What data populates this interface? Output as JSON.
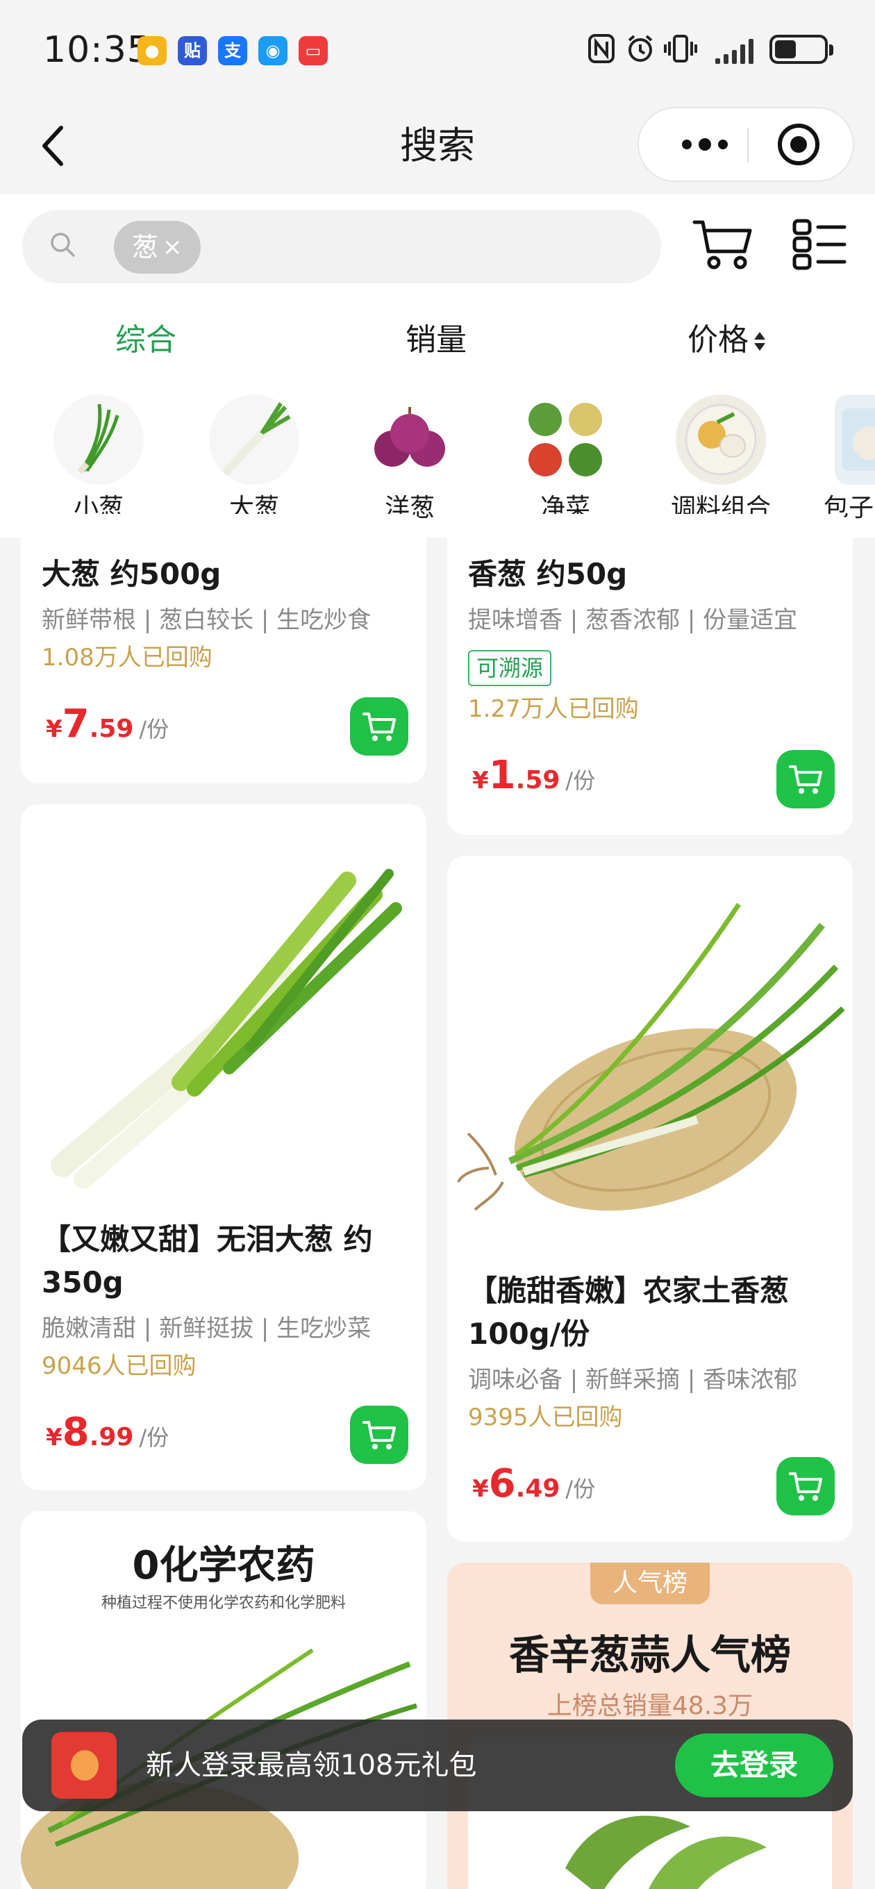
{
  "status_bar": {
    "time": "10:35",
    "notification_icons": [
      "weibo-icon",
      "tieba-icon",
      "alipay-icon",
      "message-icon",
      "mail-icon"
    ]
  },
  "nav": {
    "title": "搜索"
  },
  "search": {
    "query_chip": "葱",
    "clear_glyph": "×"
  },
  "sort_tabs": [
    {
      "label": "综合",
      "active": true
    },
    {
      "label": "销量",
      "active": false
    },
    {
      "label": "价格",
      "active": false
    }
  ],
  "categories": [
    {
      "label": "小葱"
    },
    {
      "label": "大葱"
    },
    {
      "label": "洋葱"
    },
    {
      "label": "净菜"
    },
    {
      "label": "调料组合"
    },
    {
      "label": "包子"
    }
  ],
  "products": [
    {
      "title": "大葱 约500g",
      "desc": "新鲜带根 | 葱白较长 | 生吃炒食",
      "sold": "1.08万人已回购",
      "price_int": "7",
      "price_dec": ".59",
      "unit": "/份"
    },
    {
      "title": "香葱 约50g",
      "desc": "提味增香 | 葱香浓郁 | 份量适宜",
      "badge": "可溯源",
      "sold": "1.27万人已回购",
      "price_int": "1",
      "price_dec": ".59",
      "unit": "/份"
    },
    {
      "title": "【又嫩又甜】无泪大葱 约350g",
      "desc": "脆嫩清甜 | 新鲜挺拔 | 生吃炒菜",
      "sold": "9046人已回购",
      "price_int": "8",
      "price_dec": ".99",
      "unit": "/份"
    },
    {
      "title": "【脆甜香嫩】农家土香葱100g/份",
      "desc": "调味必备 | 新鲜采摘 | 香味浓郁",
      "sold": "9395人已回购",
      "price_int": "6",
      "price_dec": ".49",
      "unit": "/份"
    }
  ],
  "currency": "¥",
  "promo_card_left": {
    "headline": "0化学农药",
    "subline": "种植过程不使用化学农药和化学肥料"
  },
  "promo_card_right": {
    "tag": "人气榜",
    "headline": "香辛葱蒜人气榜",
    "subline": "上榜总销量48.3万"
  },
  "banner": {
    "message": "新人登录最高领108元礼包",
    "button": "去登录"
  },
  "colors": {
    "accent_green": "#23a050",
    "button_green": "#1fc247",
    "price_red": "#e8282d",
    "sold_gold": "#c9a24e"
  }
}
